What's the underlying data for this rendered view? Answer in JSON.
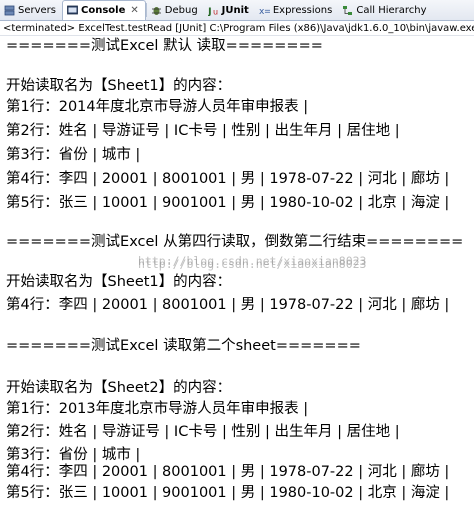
{
  "tabs": [
    {
      "label": "Servers",
      "icon": "servers-icon",
      "active": false
    },
    {
      "label": "Console",
      "icon": "console-icon",
      "active": true,
      "close": "✕"
    },
    {
      "label": "Debug",
      "icon": "debug-icon",
      "active": false
    },
    {
      "label": "JUnit",
      "icon": "junit-icon",
      "active": false
    },
    {
      "label": "Expressions",
      "icon": "expressions-icon",
      "active": false
    },
    {
      "label": "Call Hierarchy",
      "icon": "call-hierarchy-icon",
      "active": false
    }
  ],
  "status": "<terminated> ExcelTest.testRead [JUnit] C:\\Program Files (x86)\\Java\\jdk1.6.0_10\\bin\\javaw.exe (2014-",
  "console_lines": [
    "=======测试Excel 默认 读取========",
    "",
    "开始读取名为【Sheet1】的内容：",
    "第1行：2014年度北京市导游人员年审申报表 |",
    "第2行：姓名 | 导游证号 | IC卡号 | 性别 | 出生年月 | 居住地 |",
    "第3行：省份 | 城市 |",
    "第4行：李四 | 20001 | 8001001 | 男 | 1978-07-22 | 河北 | 廊坊 |",
    "第5行：张三 | 10001 | 9001001 | 男 | 1980-10-02 | 北京 | 海淀 |",
    "",
    "=======测试Excel 从第四行读取，倒数第二行结束========",
    "",
    "开始读取名为【Sheet1】的内容：",
    "第4行：李四 | 20001 | 8001001 | 男 | 1978-07-22 | 河北 | 廊坊 |",
    "",
    "=======测试Excel 读取第二个sheet=======",
    "",
    "开始读取名为【Sheet2】的内容：",
    "第1行：2013年度北京市导游人员年审申报表 |",
    "第2行：姓名 | 导游证号 | IC卡号 | 性别 | 出生年月 | 居住地 |",
    "第3行：省份 | 城市 |",
    "第4行：李四 | 20001 | 8001001 | 男 | 1978-07-22 | 河北 | 廊坊 |",
    "第5行：张三 | 10001 | 9001001 | 男 | 1980-10-02 | 北京 | 海淀 |"
  ],
  "watermarks": [
    "http://blog.csdn.net/xiaoxian8023",
    "http://blog.csdn.net/xiaoxian8023"
  ],
  "colors": {
    "tab_border": "#a9b8cf",
    "background": "#ffffff",
    "text": "#000000"
  }
}
